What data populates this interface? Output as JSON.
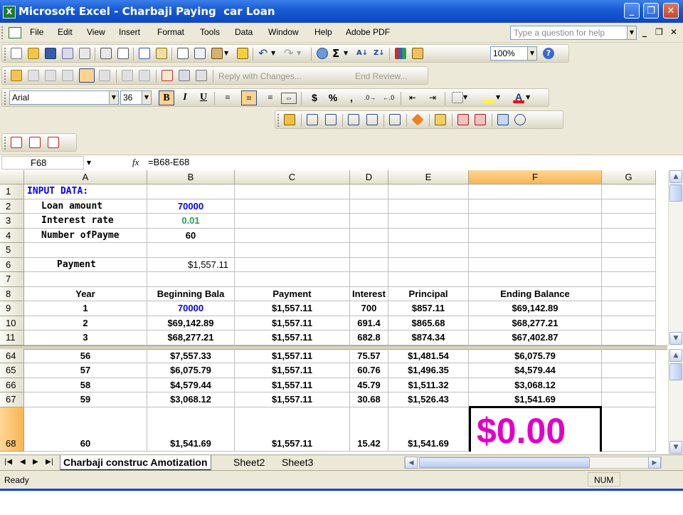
{
  "window": {
    "title": "Microsoft Excel - Charbaji Paying  car Loan",
    "app_icon": "X",
    "buttons": [
      "_",
      "❐",
      "✕"
    ]
  },
  "menu": {
    "items": [
      "File",
      "Edit",
      "View",
      "Insert",
      "Format",
      "Tools",
      "Data",
      "Window",
      "Help",
      "Adobe PDF"
    ],
    "help_placeholder": "Type a question for help",
    "mdi_buttons": [
      "_",
      "❐",
      "✕"
    ]
  },
  "toolbar": {
    "zoom": "100%",
    "reviewing_reply": "Reply with Changes...",
    "reviewing_end": "End Review...",
    "font_name": "Arial",
    "font_size": "36",
    "bold": "B",
    "italic": "I",
    "underline": "U",
    "currency": "$",
    "percent": "%",
    "comma": ",",
    "sigma": "Σ"
  },
  "formula_bar": {
    "name_box": "F68",
    "fx": "fx",
    "formula": "=B68-E68"
  },
  "columns": [
    "A",
    "B",
    "C",
    "D",
    "E",
    "F",
    "G"
  ],
  "selected_column": "F",
  "rows_top": [
    {
      "n": "1",
      "a": "INPUT DATA:"
    },
    {
      "n": "2",
      "a": "Loan amount",
      "b": "70000"
    },
    {
      "n": "3",
      "a": "Interest rate",
      "b": "0.01"
    },
    {
      "n": "4",
      "a": "Number ofPayme",
      "b": "60"
    },
    {
      "n": "5"
    },
    {
      "n": "6",
      "a": "Payment",
      "b": "$1,557.11"
    },
    {
      "n": "7"
    },
    {
      "n": "8",
      "a": "Year",
      "b": "Beginning Bala",
      "c": "Payment",
      "d": "Interest",
      "e": "Principal",
      "f": "Ending Balance"
    },
    {
      "n": "9",
      "a": "1",
      "b": "70000",
      "c": "$1,557.11",
      "d": "700",
      "e": "$857.11",
      "f": "$69,142.89"
    },
    {
      "n": "10",
      "a": "2",
      "b": "$69,142.89",
      "c": "$1,557.11",
      "d": "691.4",
      "e": "$865.68",
      "f": "$68,277.21"
    },
    {
      "n": "11",
      "a": "3",
      "b": "$68,277.21",
      "c": "$1,557.11",
      "d": "682.8",
      "e": "$874.34",
      "f": "$67,402.87"
    }
  ],
  "rows_bottom": [
    {
      "n": "64",
      "a": "56",
      "b": "$7,557.33",
      "c": "$1,557.11",
      "d": "75.57",
      "e": "$1,481.54",
      "f": "$6,075.79"
    },
    {
      "n": "65",
      "a": "57",
      "b": "$6,075.79",
      "c": "$1,557.11",
      "d": "60.76",
      "e": "$1,496.35",
      "f": "$4,579.44"
    },
    {
      "n": "66",
      "a": "58",
      "b": "$4,579.44",
      "c": "$1,557.11",
      "d": "45.79",
      "e": "$1,511.32",
      "f": "$3,068.12"
    },
    {
      "n": "67",
      "a": "59",
      "b": "$3,068.12",
      "c": "$1,557.11",
      "d": "30.68",
      "e": "$1,526.43",
      "f": "$1,541.69"
    },
    {
      "n": "68",
      "a": "60",
      "b": "$1,541.69",
      "c": "$1,557.11",
      "d": "15.42",
      "e": "$1,541.69",
      "f": "$0.00"
    }
  ],
  "sheet_tabs": [
    "Charbaji construc Amotization",
    "Sheet2",
    "Sheet3"
  ],
  "active_tab": "Charbaji construc Amotization",
  "status": {
    "left": "Ready",
    "num": "NUM"
  },
  "colors": {
    "title_blue": "#1a5cd6",
    "input_blue": "#0000ff",
    "rate_green": "#239a5a",
    "result_magenta": "#e000c8",
    "selection_orange": "#f7b552"
  }
}
